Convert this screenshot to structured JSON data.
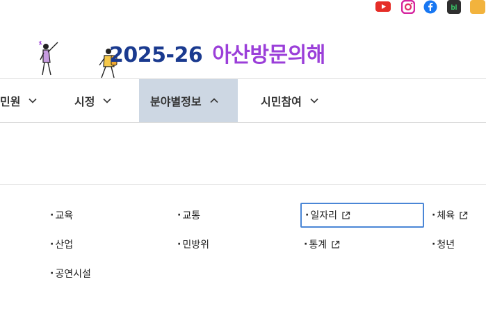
{
  "social": [
    {
      "name": "youtube-icon",
      "color": "#e52d27"
    },
    {
      "name": "instagram-icon",
      "color": "#d6249f"
    },
    {
      "name": "facebook-icon",
      "color": "#1877f2"
    },
    {
      "name": "blog-icon",
      "color": "#2f2f2f",
      "text": "bl"
    }
  ],
  "banner": {
    "year": "2025-26",
    "subtitle": "아산방문의해"
  },
  "gnb": [
    {
      "label": "민원",
      "active": false
    },
    {
      "label": "시정",
      "active": false
    },
    {
      "label": "분야별정보",
      "active": true
    },
    {
      "label": "시민참여",
      "active": false
    }
  ],
  "submenu": {
    "bullet": "·",
    "items": [
      {
        "label": "교육",
        "external": false
      },
      {
        "label": "교통",
        "external": false
      },
      {
        "label": "일자리",
        "external": true,
        "focused": true
      },
      {
        "label": "체육",
        "external": true
      },
      {
        "label": "산업",
        "external": false
      },
      {
        "label": "민방위",
        "external": false
      },
      {
        "label": "통계",
        "external": true
      },
      {
        "label": "청년",
        "external": false
      },
      {
        "label": "공연시설",
        "external": false
      }
    ]
  },
  "colors": {
    "accent_blue": "#1a3a8f",
    "accent_purple": "#9b3fd9",
    "active_tab_bg": "#cdd7e3",
    "focus_outline": "#4a86d6"
  }
}
